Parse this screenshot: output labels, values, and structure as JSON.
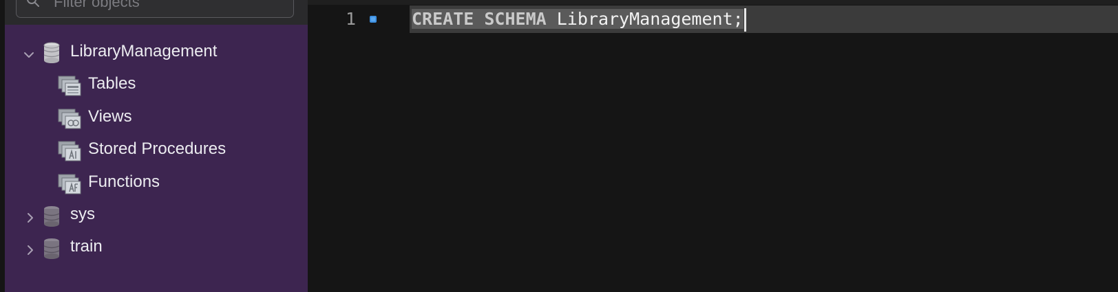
{
  "colors": {
    "sidebar_bg": "#3d2550",
    "editor_bg": "#151515",
    "current_line_bg": "#3b3b3b",
    "selection_bg": "#5a5a5a",
    "marker_blue": "#3d8fe0"
  },
  "filter": {
    "placeholder": "Filter objects",
    "icon": "search-icon"
  },
  "schemas": [
    {
      "name": "LibraryManagement",
      "expanded": true,
      "icon": "database-icon",
      "children": [
        {
          "label": "Tables",
          "icon": "tables-folder-icon"
        },
        {
          "label": "Views",
          "icon": "views-folder-icon"
        },
        {
          "label": "Stored Procedures",
          "icon": "procedures-folder-icon"
        },
        {
          "label": "Functions",
          "icon": "functions-folder-icon"
        }
      ]
    },
    {
      "name": "sys",
      "expanded": false,
      "icon": "database-icon"
    },
    {
      "name": "train",
      "expanded": false,
      "icon": "database-icon"
    }
  ],
  "editor": {
    "line_number": "1",
    "code": {
      "keyword1": "CREATE",
      "keyword2": "SCHEMA",
      "identifier": "LibraryManagement;"
    }
  }
}
